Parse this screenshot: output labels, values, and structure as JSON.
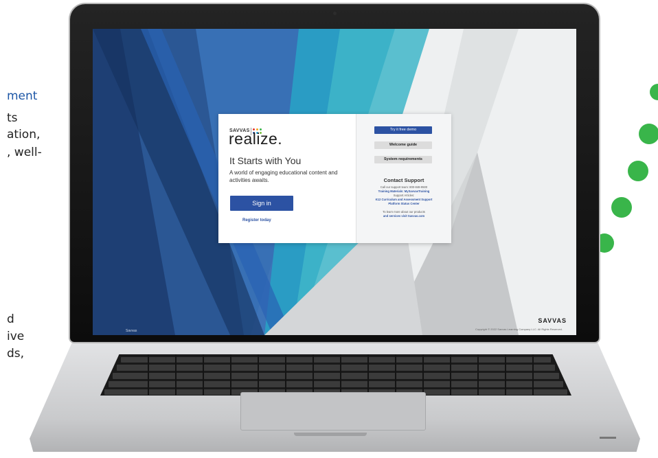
{
  "background_text": {
    "heading_fragment": "ment",
    "lines_top": [
      "ts",
      "ation,",
      ", well-"
    ],
    "lines_bottom": [
      "d",
      "ive",
      "ds,"
    ]
  },
  "login": {
    "brand_small": "SAVVAS",
    "brand_logo": "realize.",
    "tagline": "It Starts with You",
    "subtitle": "A world of engaging educational content and activities awaits.",
    "sign_in_label": "Sign in",
    "register_label": "Register today"
  },
  "side_panel": {
    "buttons": [
      "Try it free demo",
      "Welcome guide",
      "System requirements"
    ],
    "contact_title": "Contact Support",
    "contact_lines": [
      "Call our support team: 800-848-9500",
      "Training Materials: MySavvasTraining",
      "Support Articles:",
      "K12 Curriculum and Assessment Support",
      "Platform Status Center",
      "To learn more about our products",
      "and services visit Savvas.com"
    ]
  },
  "footer": {
    "left": "Savvas",
    "brand": "SAVVAS",
    "copyright": "Copyright © 2022 Savvas Learning Company LLC. All Rights Reserved."
  },
  "colors": {
    "accent": "#2c52a3",
    "dots_green": "#39b54a"
  }
}
